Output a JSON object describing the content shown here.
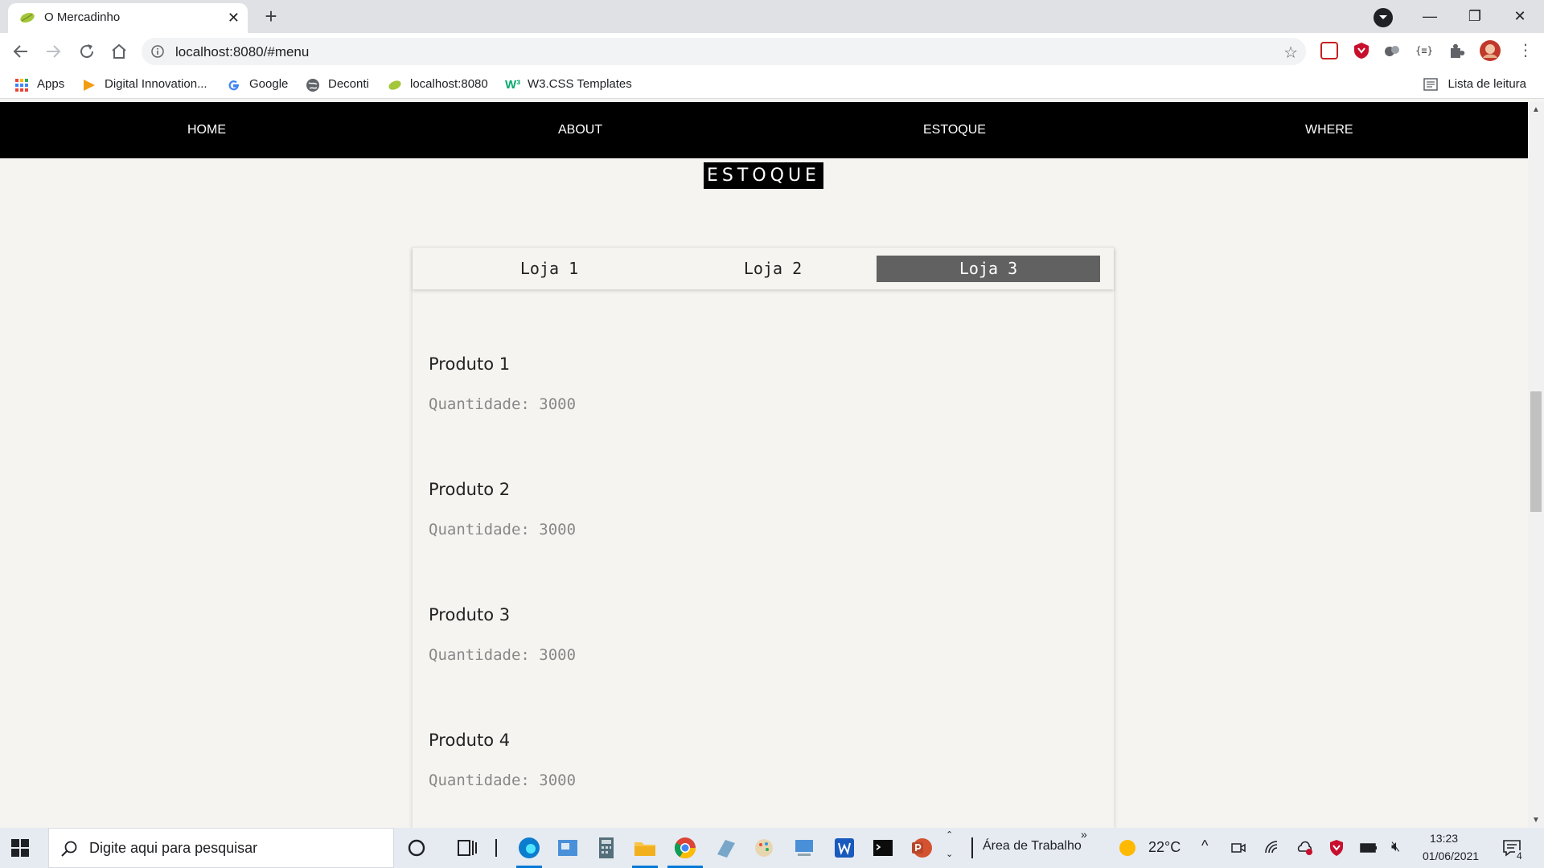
{
  "browser": {
    "tab_title": "O Mercadinho",
    "tab_close": "✕",
    "new_tab": "+",
    "url": "localhost:8080/#menu",
    "window_min": "—",
    "window_restore": "❐",
    "window_close": "✕"
  },
  "bookmarks": {
    "items": [
      {
        "label": "Apps",
        "icon": "apps-grid-icon"
      },
      {
        "label": "Digital Innovation...",
        "icon": "dio-icon"
      },
      {
        "label": "Google",
        "icon": "google-icon"
      },
      {
        "label": "Deconti",
        "icon": "globe-icon"
      },
      {
        "label": "localhost:8080",
        "icon": "leaf-icon"
      },
      {
        "label": "W3.CSS Templates",
        "icon": "w3-icon"
      }
    ],
    "reading_list": "Lista de leitura"
  },
  "nav": {
    "home": "HOME",
    "about": "ABOUT",
    "estoque": "ESTOQUE",
    "where": "WHERE"
  },
  "section_title": "ESTOQUE",
  "store_tabs": [
    {
      "label": "Loja 1",
      "active": false
    },
    {
      "label": "Loja 2",
      "active": false
    },
    {
      "label": "Loja 3",
      "active": true
    }
  ],
  "products": [
    {
      "name": "Produto 1",
      "quantity": "Quantidade: 3000"
    },
    {
      "name": "Produto 2",
      "quantity": "Quantidade: 3000"
    },
    {
      "name": "Produto 3",
      "quantity": "Quantidade: 3000"
    },
    {
      "name": "Produto 4",
      "quantity": "Quantidade: 3000"
    }
  ],
  "taskbar": {
    "search_placeholder": "Digite aqui para pesquisar",
    "desktop_label": "Área de Trabalho",
    "chevrons": "»",
    "temperature": "22°C",
    "time": "13:23",
    "date": "01/06/2021",
    "notifications": "4"
  },
  "colors": {
    "nav_bg": "#000000",
    "active_tab": "#616161",
    "page_bg": "#f5f4f1"
  }
}
